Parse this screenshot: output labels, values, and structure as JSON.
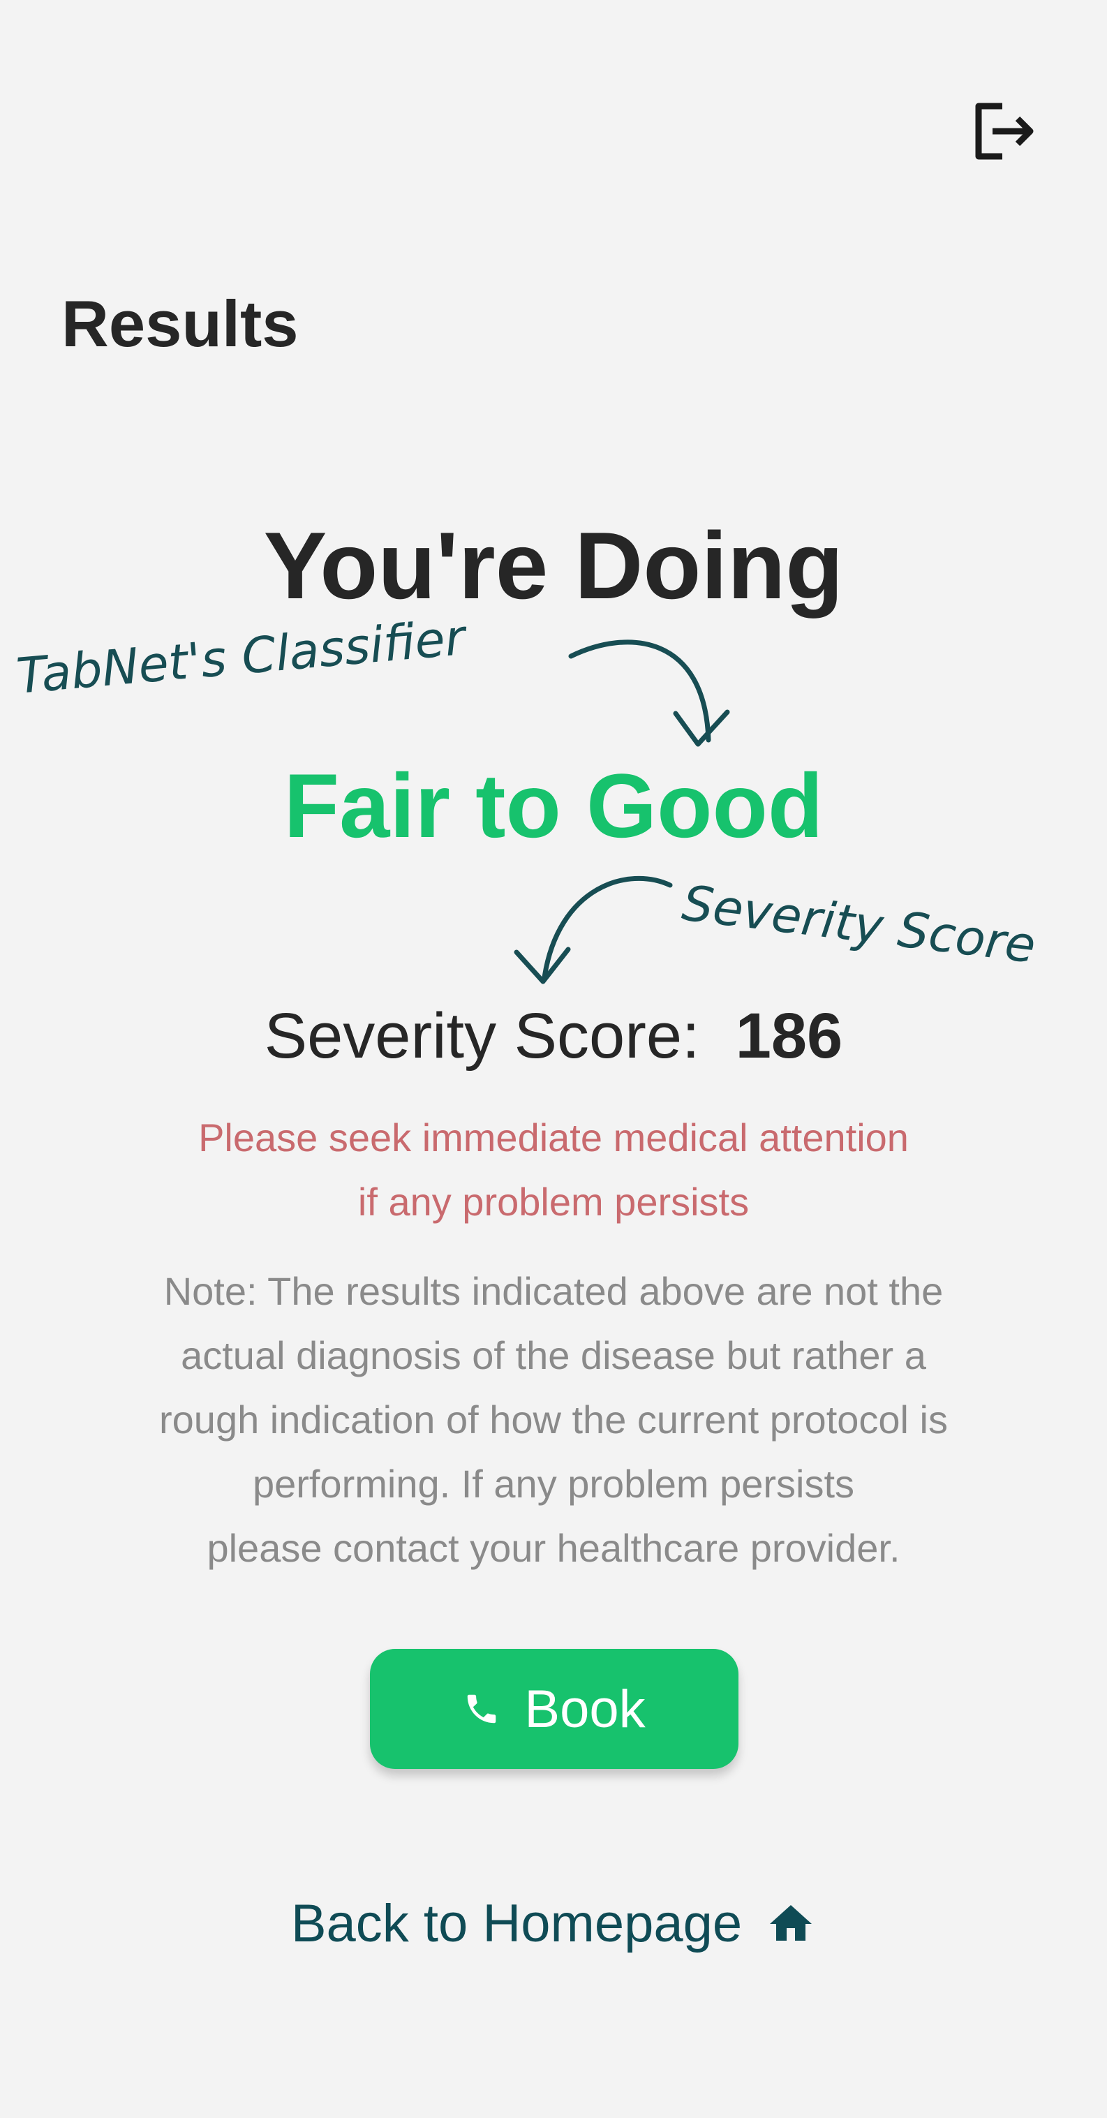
{
  "header": {
    "logout_icon": "logout-icon"
  },
  "page_title": "Results",
  "result": {
    "heading": "You're Doing",
    "status": "Fair to Good",
    "severity_label": "Severity Score:",
    "severity_value": "186"
  },
  "warning": {
    "line1": "Please seek immediate medical attention",
    "line2": "if any problem persists"
  },
  "note": {
    "lines": [
      "Note: The results indicated above are not the",
      "actual diagnosis of the disease but rather a",
      "rough indication of how the current protocol is",
      "performing. If any problem persists",
      "please contact your healthcare provider."
    ]
  },
  "book_button": {
    "label": "Book",
    "icon": "phone-icon"
  },
  "back_link": {
    "label": "Back to Homepage",
    "icon": "home-icon"
  },
  "annotations": {
    "classifier": "TabNet's Classifier",
    "severity": "Severity Score"
  },
  "colors": {
    "accent_green": "#17c26d",
    "warning_red": "#c96a6e",
    "link_teal": "#0f4b55",
    "annotation_teal": "#174d53"
  }
}
